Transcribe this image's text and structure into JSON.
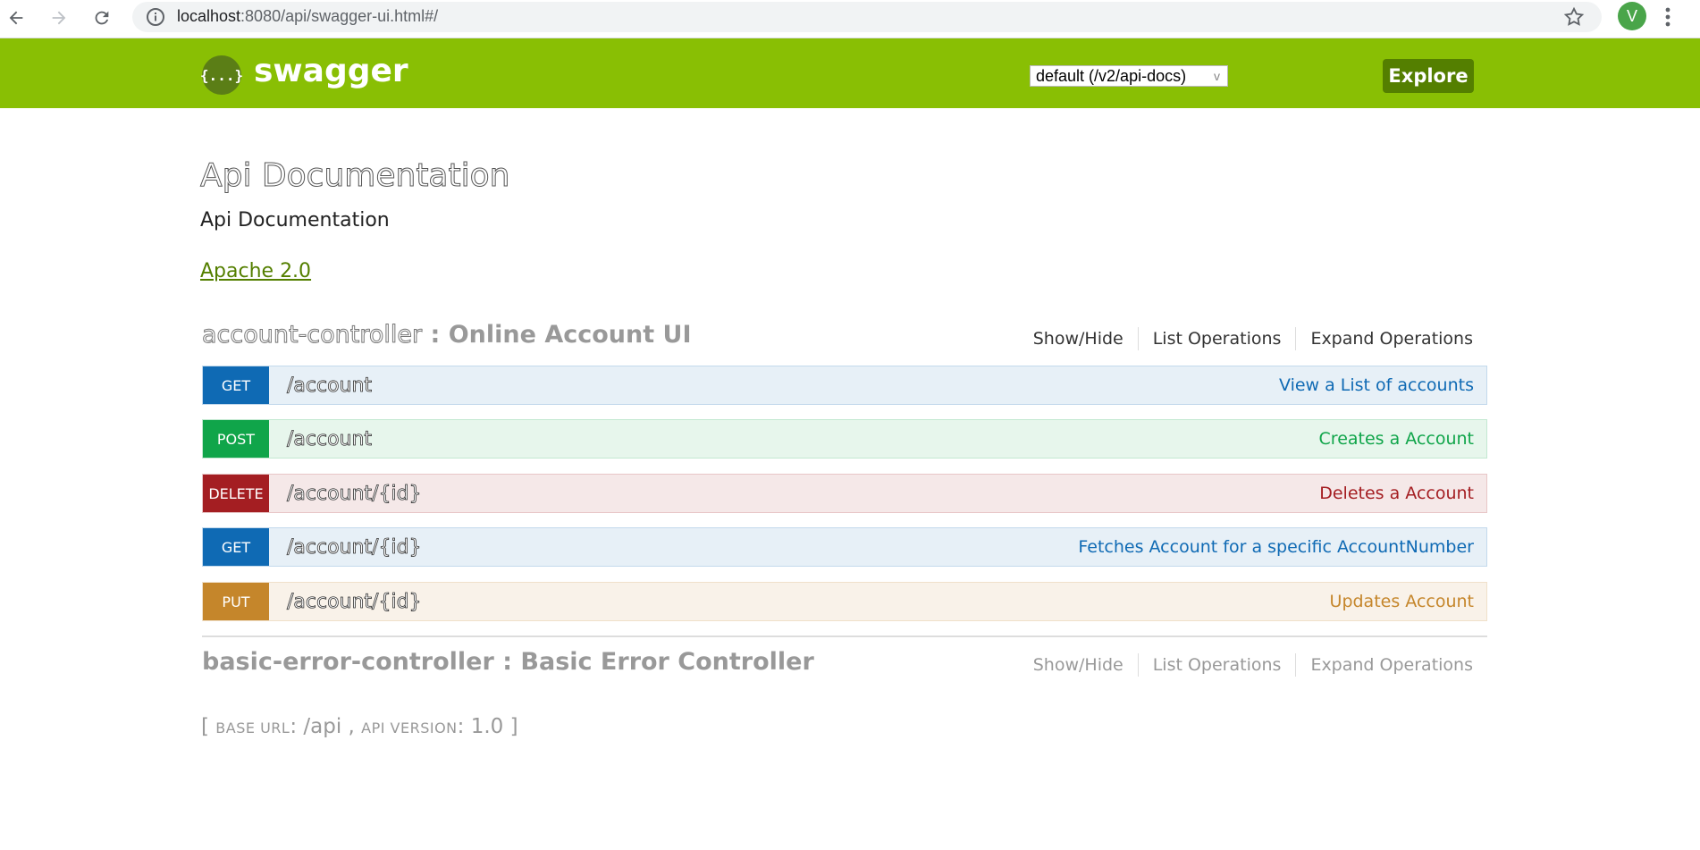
{
  "browser": {
    "url_host": "localhost",
    "url_rest": ":8080/api/swagger-ui.html#/",
    "avatar_letter": "V",
    "icons": [
      "back-arrow-icon",
      "forward-arrow-icon",
      "reload-icon",
      "info-icon",
      "star-icon",
      "kebab-menu-icon"
    ]
  },
  "header": {
    "logo_symbol": "{...}",
    "logo_text": "swagger",
    "spec_selected": "default (/v2/api-docs)",
    "explore_label": "Explore",
    "colors": {
      "bar": "#89bf04",
      "button": "#547f00"
    }
  },
  "info": {
    "title": "Api Documentation",
    "description": "Api Documentation",
    "license": "Apache 2.0"
  },
  "resources": [
    {
      "name": "account-controller",
      "separator": " : ",
      "description": "Online Account UI",
      "links": [
        "Show/Hide",
        "List Operations",
        "Expand Operations"
      ],
      "operations": [
        {
          "method": "GET",
          "path": "/account",
          "summary": "View a List of accounts"
        },
        {
          "method": "POST",
          "path": "/account",
          "summary": "Creates a Account"
        },
        {
          "method": "DELETE",
          "path": "/account/{id}",
          "summary": "Deletes a Account"
        },
        {
          "method": "GET",
          "path": "/account/{id}",
          "summary": "Fetches Account for a specific AccountNumber"
        },
        {
          "method": "PUT",
          "path": "/account/{id}",
          "summary": "Updates Account"
        }
      ]
    },
    {
      "name": "basic-error-controller",
      "separator": " : ",
      "description": "Basic Error Controller",
      "links": [
        "Show/Hide",
        "List Operations",
        "Expand Operations"
      ],
      "operations": []
    }
  ],
  "footer": {
    "open": "[ ",
    "base_url_label": "base url",
    "base_url_value": ": /api , ",
    "api_version_label": "api version",
    "api_version_value": ": 1.0 ]"
  },
  "method_colors": {
    "GET": "#0f6ab4",
    "POST": "#10a54a",
    "DELETE": "#a41e22",
    "PUT": "#c5862b"
  }
}
